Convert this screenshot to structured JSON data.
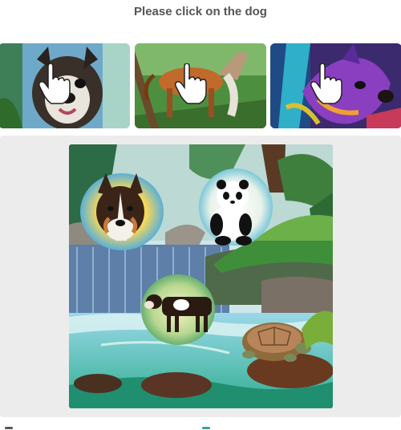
{
  "prompt": "Please click on the dog",
  "examples": [
    {
      "name": "dog-example",
      "subject": "dog"
    },
    {
      "name": "horse-example",
      "subject": "horse"
    },
    {
      "name": "dog-example",
      "subject": "dog"
    }
  ],
  "puzzle": {
    "animals": [
      "dog",
      "panda",
      "cow",
      "turtle"
    ]
  },
  "colors": {
    "panel_bg": "#ececec",
    "title": "#555555",
    "water": "#2fae8f"
  }
}
